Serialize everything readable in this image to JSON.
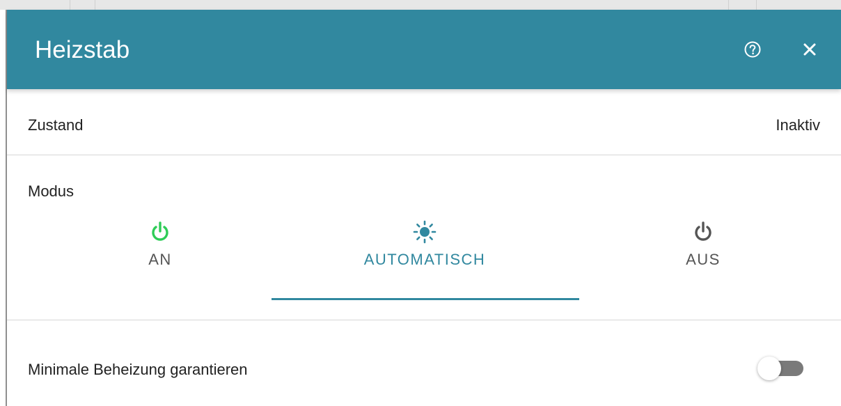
{
  "dialog": {
    "title": "Heizstab",
    "help_icon": "help-circle-icon",
    "close_icon": "close-icon"
  },
  "state": {
    "label": "Zustand",
    "value": "Inaktiv"
  },
  "mode": {
    "label": "Modus",
    "selected": "AUTOMATISCH",
    "options": [
      {
        "label": "AN",
        "icon": "power-icon",
        "color": "#2ecc57"
      },
      {
        "label": "AUTOMATISCH",
        "icon": "sun-icon",
        "color": "#31889f"
      },
      {
        "label": "AUS",
        "icon": "power-icon",
        "color": "#555555"
      }
    ]
  },
  "min_heating": {
    "label": "Minimale Beheizung garantieren",
    "enabled": false
  },
  "colors": {
    "header": "#31889f",
    "accent": "#31889f",
    "on": "#2ecc57"
  }
}
